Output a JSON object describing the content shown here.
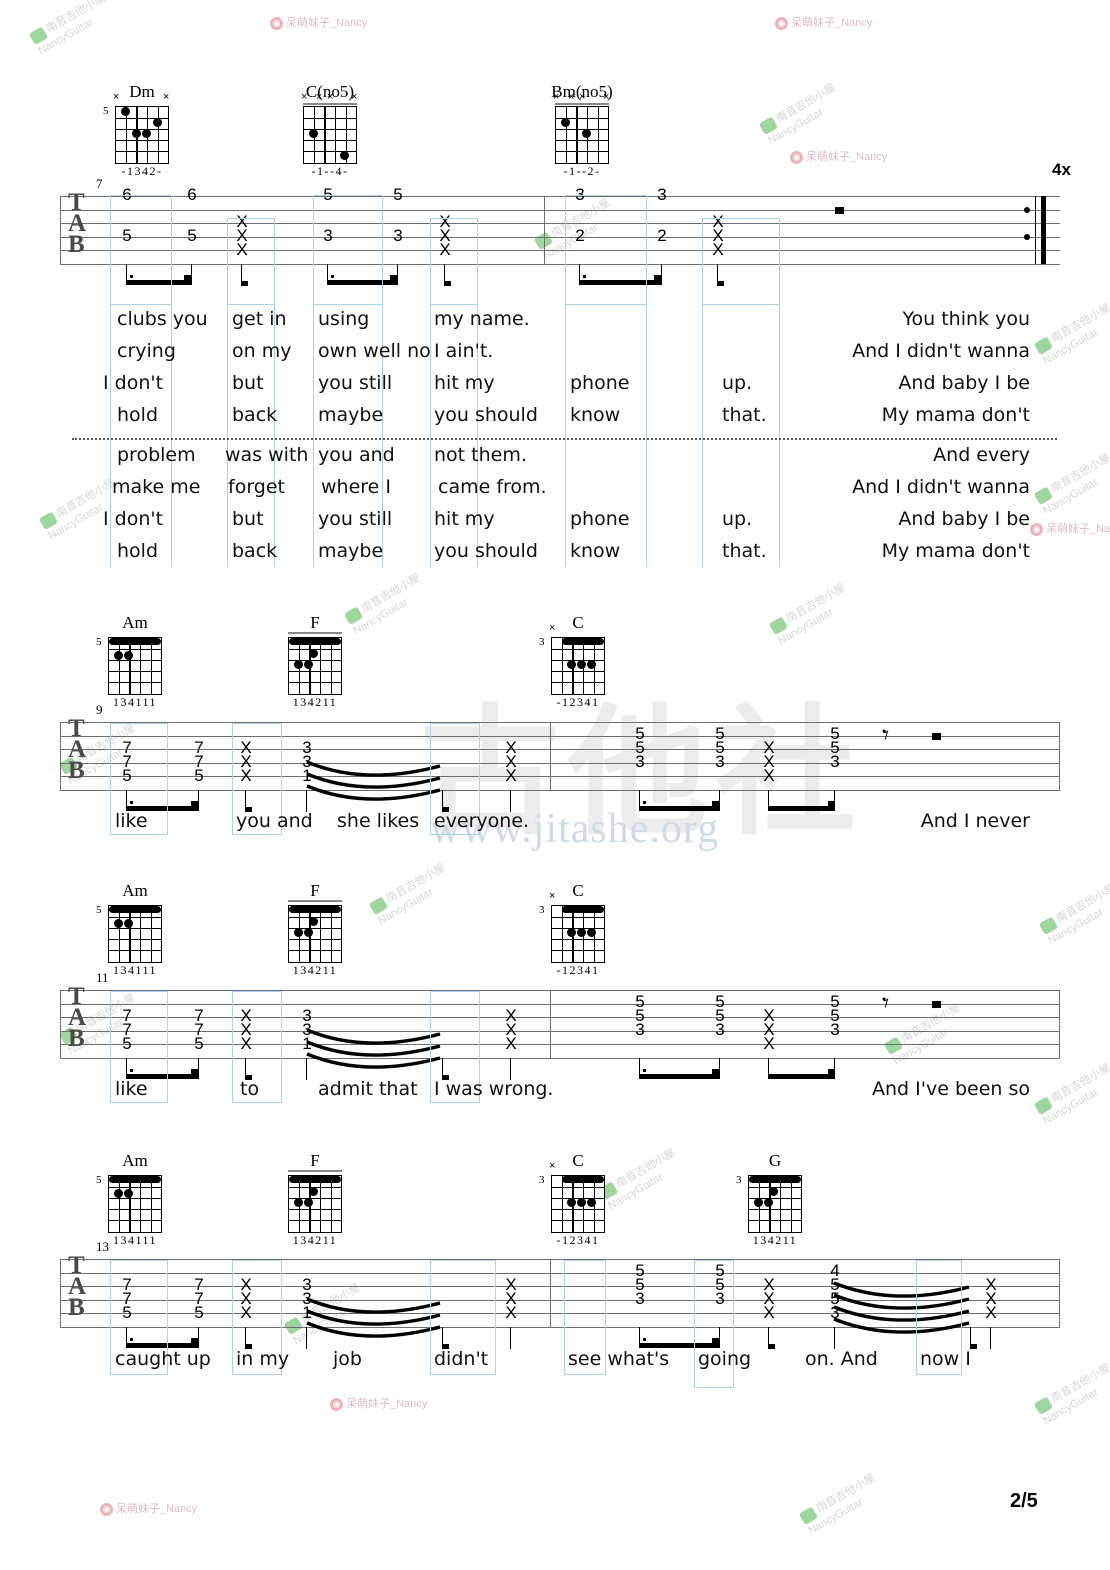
{
  "page": {
    "number": "2/5",
    "repeat_marking": "4x"
  },
  "watermarks": {
    "site_url": "www.jitashe.org",
    "big_cn": "古他社",
    "nancy_line1": "南音吉他小屋",
    "nancy_line2": "NancyGuitar",
    "weibo": "呆萌妹子_Nancy",
    "nancy_tag": "NancyGuitar_Nancy"
  },
  "systems": [
    {
      "id": "system-1",
      "measure_start": "7",
      "chords": [
        {
          "name": "Dm",
          "base_fret": "5",
          "fingers": "-1342-",
          "muted": "x--- x"
        },
        {
          "name": "C(no5)",
          "base_fret": "",
          "fingers": "-1--4-",
          "muted": "x xx x"
        },
        {
          "name": "Bm(no5)",
          "base_fret": "",
          "fingers": "-1--2-",
          "muted": "x xx x"
        }
      ],
      "tab_groups": [
        {
          "label": "Dm",
          "notes": [
            "6",
            "6"
          ],
          "bass": [
            "5",
            "5"
          ]
        },
        {
          "label": "mute",
          "notes": [
            "X",
            "X",
            "X"
          ]
        },
        {
          "label": "C(no5)",
          "notes": [
            "5",
            "5"
          ],
          "bass": [
            "3",
            "3"
          ]
        },
        {
          "label": "mute",
          "notes": [
            "X",
            "X",
            "X"
          ]
        },
        {
          "label": "Bm(no5)",
          "notes": [
            "3",
            "3"
          ],
          "bass": [
            "2",
            "2"
          ]
        },
        {
          "label": "mute",
          "notes": [
            "X",
            "X",
            "X"
          ]
        }
      ],
      "lyrics_block_a": [
        [
          "clubs you",
          "get in",
          "using",
          "my name.",
          "",
          "",
          "You think you"
        ],
        [
          "crying",
          "on my",
          "own well no",
          "I ain't.",
          "",
          "",
          "And I didn't wanna"
        ],
        [
          "I don't",
          "but",
          "you still",
          "hit my",
          "phone",
          "up.",
          "And baby I be"
        ],
        [
          "hold",
          "back",
          "maybe",
          "you should",
          "know",
          "that.",
          "My mama don't"
        ]
      ],
      "lyrics_block_b": [
        [
          "problem",
          "was with",
          "you and",
          "not them.",
          "",
          "",
          "And every"
        ],
        [
          "make me",
          "forget",
          "where I",
          "came from.",
          "",
          "",
          "And I didn't wanna"
        ],
        [
          "I don't",
          "but",
          "you still",
          "hit my",
          "phone",
          "up.",
          "And baby I be"
        ],
        [
          "hold",
          "back",
          "maybe",
          "you should",
          "know",
          "that.",
          "My mama don't"
        ]
      ]
    },
    {
      "id": "system-2",
      "measure_start": "9",
      "chords": [
        {
          "name": "Am",
          "base_fret": "5",
          "fingers": "134111",
          "muted": ""
        },
        {
          "name": "F",
          "base_fret": "",
          "fingers": "134211",
          "muted": ""
        },
        {
          "name": "C",
          "base_fret": "3",
          "fingers": "-12341",
          "muted": "x"
        }
      ],
      "tab_text": [
        "7",
        "7",
        "7",
        "7",
        "5",
        "5",
        "X",
        "X",
        "X",
        "3",
        "3",
        "1",
        "X",
        "X",
        "X",
        "5",
        "5",
        "3",
        "5",
        "5",
        "3",
        "X",
        "X",
        "X",
        "5",
        "5",
        "3"
      ],
      "lyrics": [
        "like",
        "you and",
        "she likes",
        "everyone.",
        "And I never"
      ]
    },
    {
      "id": "system-3",
      "measure_start": "11",
      "chords": [
        {
          "name": "Am",
          "base_fret": "5",
          "fingers": "134111",
          "muted": ""
        },
        {
          "name": "F",
          "base_fret": "",
          "fingers": "134211",
          "muted": ""
        },
        {
          "name": "C",
          "base_fret": "3",
          "fingers": "-12341",
          "muted": "x"
        }
      ],
      "lyrics": [
        "like",
        "to",
        "admit that",
        "I was wrong.",
        "And I've been so"
      ]
    },
    {
      "id": "system-4",
      "measure_start": "13",
      "chords": [
        {
          "name": "Am",
          "base_fret": "5",
          "fingers": "134111",
          "muted": ""
        },
        {
          "name": "F",
          "base_fret": "",
          "fingers": "134211",
          "muted": ""
        },
        {
          "name": "C",
          "base_fret": "3",
          "fingers": "-12341",
          "muted": "x"
        },
        {
          "name": "G",
          "base_fret": "3",
          "fingers": "134211",
          "muted": ""
        }
      ],
      "lyrics": [
        "caught up",
        "in my",
        "job",
        "didn't",
        "see what's",
        "going",
        "on. And",
        "now I"
      ]
    }
  ]
}
